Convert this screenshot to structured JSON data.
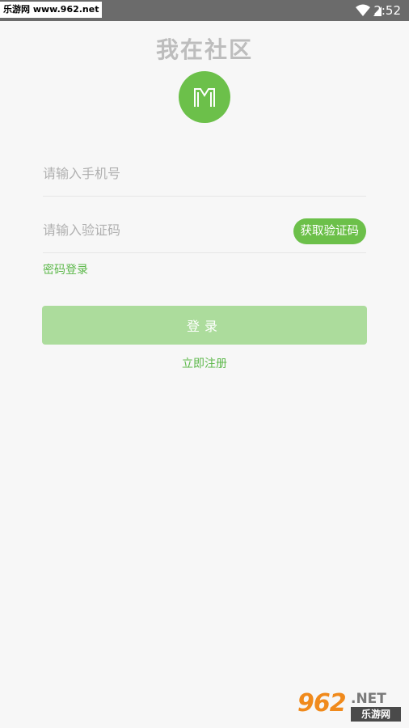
{
  "status_bar": {
    "watermark": "乐游网 www.962.net",
    "time": "2:52"
  },
  "header": {
    "title": "我在社区",
    "logo_icon": "community-logo-icon",
    "accent_color": "#6cc04a"
  },
  "form": {
    "phone_placeholder": "请输入手机号",
    "code_placeholder": "请输入验证码",
    "get_code_label": "获取验证码",
    "password_login_label": "密码登录",
    "login_label": "登录",
    "register_label": "立即注册"
  },
  "watermark": {
    "big": "962",
    "net": ".NET",
    "cn": "乐游网"
  }
}
